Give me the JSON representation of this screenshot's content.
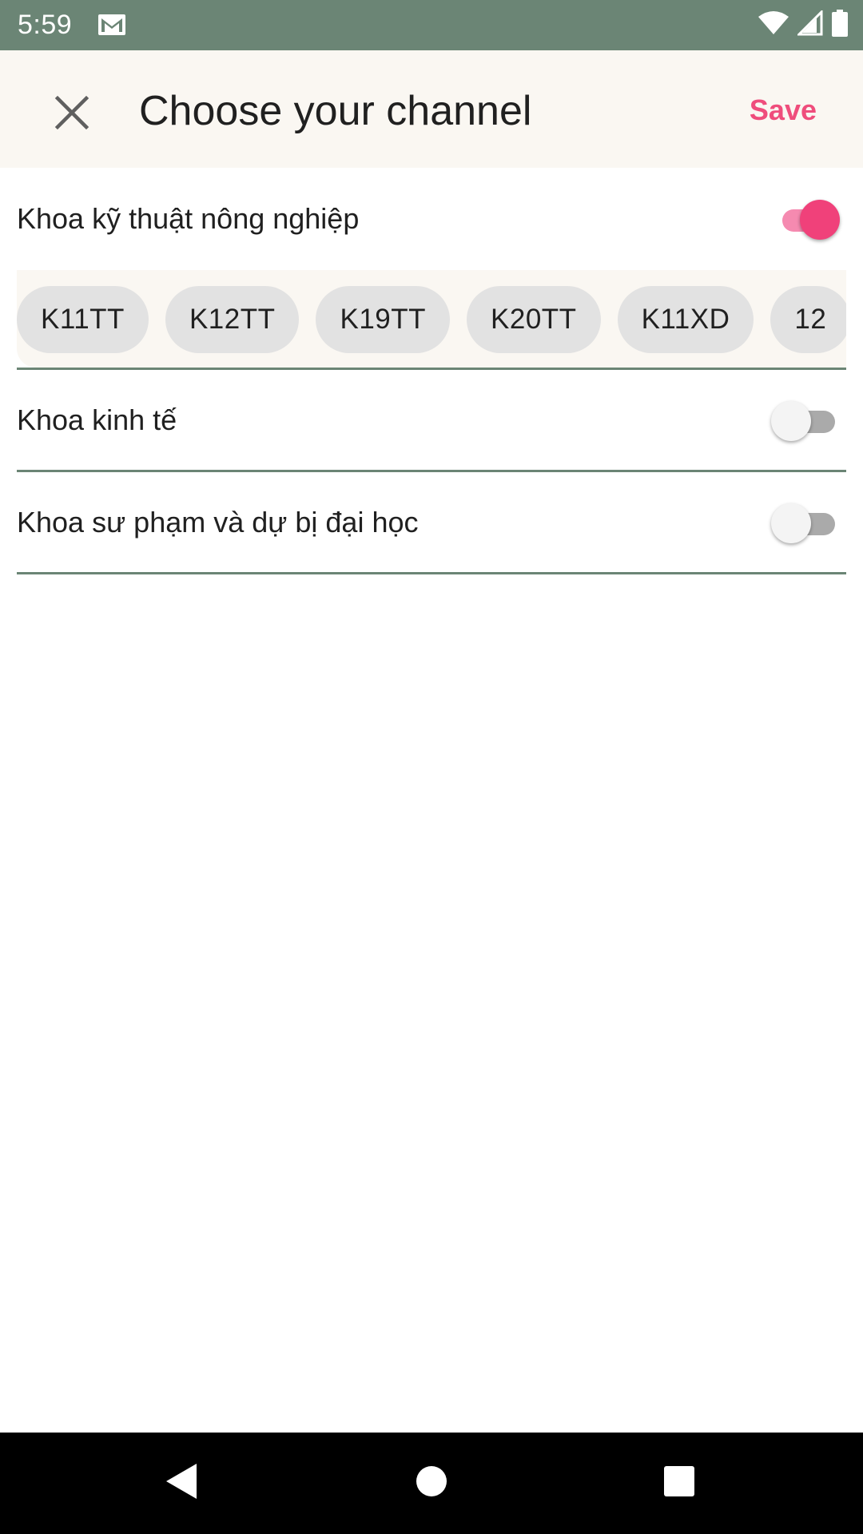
{
  "status_bar": {
    "time": "5:59",
    "icons": [
      "gmail-icon",
      "wifi-icon",
      "cell-signal-icon",
      "battery-icon"
    ]
  },
  "app_bar": {
    "close_icon": "close-icon",
    "title": "Choose your channel",
    "save_label": "Save"
  },
  "sections": [
    {
      "label": "Khoa kỹ thuật nông nghiệp",
      "enabled": true,
      "chips": [
        "K11TT",
        "K12TT",
        "K19TT",
        "K20TT",
        "K11XD",
        "12"
      ]
    },
    {
      "label": "Khoa kinh tế",
      "enabled": false
    },
    {
      "label": "Khoa sư phạm và dự bị đại học",
      "enabled": false
    }
  ],
  "nav_bar": {
    "buttons": [
      "back-icon",
      "home-icon",
      "recents-icon"
    ]
  },
  "colors": {
    "status_bar": "#6b8575",
    "accent": "#ef4d7c",
    "app_bar": "#faf7f2",
    "divider": "#6b8575",
    "chip": "#e2e2e2"
  }
}
